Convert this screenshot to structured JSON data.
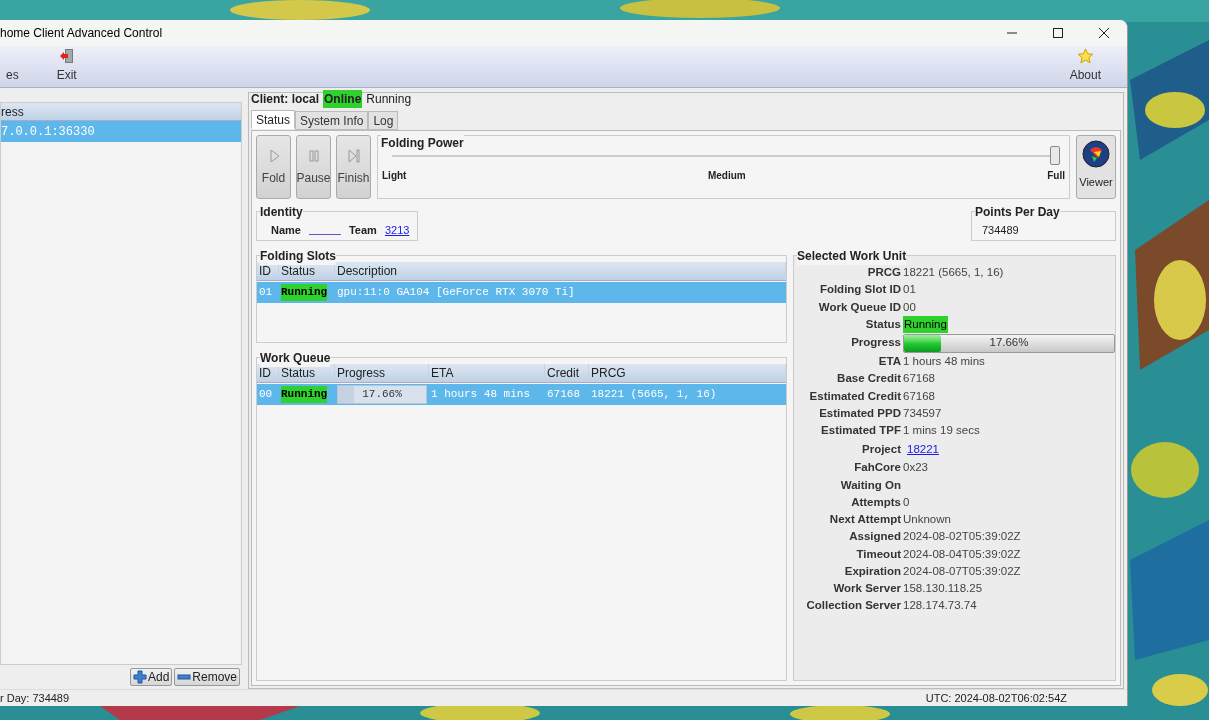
{
  "window": {
    "title": "home Client Advanced Control"
  },
  "toolbar": [
    {
      "label": "es",
      "kind": "prefs"
    },
    {
      "label": "Exit",
      "kind": "exit"
    },
    {
      "label": "About",
      "kind": "about"
    }
  ],
  "clients": {
    "columns": [
      "ress"
    ],
    "rows": [
      {
        "address": "7.0.0.1:36330",
        "selected": true
      }
    ],
    "buttons": [
      {
        "label": "Add",
        "kind": "add"
      },
      {
        "label": "Remove",
        "kind": "remove"
      }
    ]
  },
  "client": {
    "label": "Client: local",
    "connection": "Online",
    "state": "Running"
  },
  "tabs": [
    {
      "label": "Status",
      "selected": true
    },
    {
      "label": "System Info",
      "selected": false
    },
    {
      "label": "Log",
      "selected": false
    }
  ],
  "actions": [
    {
      "label": "Fold",
      "kind": "fold"
    },
    {
      "label": "Pause",
      "kind": "pause"
    },
    {
      "label": "Finish",
      "kind": "finish"
    }
  ],
  "folding_power": {
    "title": "Folding Power",
    "level": 1,
    "ticks": [
      "Light",
      "Medium",
      "Full"
    ]
  },
  "viewer": {
    "label": "Viewer"
  },
  "identity": {
    "title": "Identity",
    "name_label": "Name",
    "team_label": "Team",
    "team": "3213"
  },
  "ppd": {
    "title": "Points Per Day",
    "value": "734489"
  },
  "folding_slots": {
    "title": "Folding Slots",
    "columns": [
      "ID",
      "Status",
      "Description"
    ],
    "rows": [
      {
        "id": "01",
        "status": "Running",
        "description": "gpu:11:0 GA104 [GeForce RTX 3070 Ti]",
        "selected": true
      }
    ]
  },
  "work_queue": {
    "title": "Work Queue",
    "columns": [
      "ID",
      "Status",
      "Progress",
      "ETA",
      "Credit",
      "PRCG"
    ],
    "rows": [
      {
        "id": "00",
        "status": "Running",
        "progress": "17.66%",
        "level": 0.1766,
        "eta": "1 hours 48 mins",
        "credit": "67168",
        "prcg": "18221 (5665, 1, 16)",
        "selected": true
      }
    ]
  },
  "work_unit": {
    "title": "Selected Work Unit",
    "fields": [
      {
        "label": "PRCG",
        "value": "18221 (5665, 1, 16)",
        "kind": "text"
      },
      {
        "label": "Folding Slot ID",
        "value": "01",
        "kind": "text"
      },
      {
        "label": "Work Queue ID",
        "value": "00",
        "kind": "text"
      },
      {
        "label": "Status",
        "value": "Running",
        "kind": "status"
      },
      {
        "label": "Progress",
        "value": "17.66%",
        "kind": "progress",
        "level": 0.1766
      },
      {
        "label": "ETA",
        "value": "1 hours 48 mins",
        "kind": "text"
      },
      {
        "label": "Base Credit",
        "value": "67168",
        "kind": "text"
      },
      {
        "label": "Estimated Credit",
        "value": "67168",
        "kind": "text"
      },
      {
        "label": "Estimated PPD",
        "value": "734597",
        "kind": "text"
      },
      {
        "label": "Estimated TPF",
        "value": "1 mins 19 secs",
        "kind": "text"
      },
      {
        "label": "Project",
        "value": "18221",
        "kind": "link"
      },
      {
        "label": "FahCore",
        "value": "0x23",
        "kind": "text"
      },
      {
        "label": "Waiting On",
        "kind": "text"
      },
      {
        "label": "Attempts",
        "value": "0",
        "kind": "text"
      },
      {
        "label": "Next Attempt",
        "value": "Unknown",
        "kind": "text"
      },
      {
        "label": "Assigned",
        "value": "2024-08-02T05:39:02Z",
        "kind": "text"
      },
      {
        "label": "Timeout",
        "value": "2024-08-04T05:39:02Z",
        "kind": "text"
      },
      {
        "label": "Expiration",
        "value": "2024-08-07T05:39:02Z",
        "kind": "text"
      },
      {
        "label": "Work Server",
        "value": "158.130.118.25",
        "kind": "text"
      },
      {
        "label": "Collection Server",
        "value": "128.174.73.74",
        "kind": "text"
      }
    ]
  },
  "status_bar": {
    "left": "r Day: 734489",
    "right": "UTC: 2024-08-02T06:02:54Z"
  }
}
